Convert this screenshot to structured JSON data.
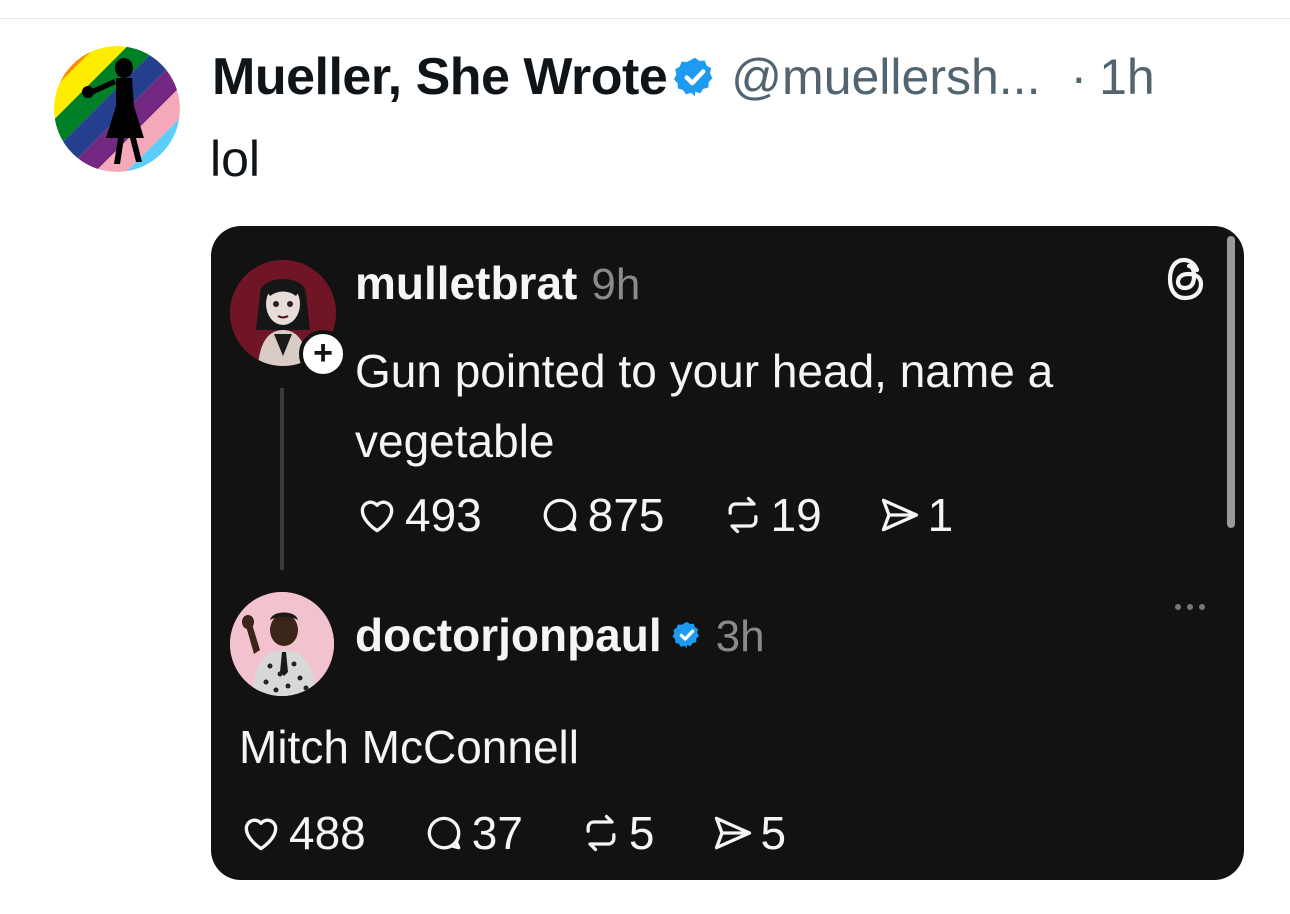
{
  "tweet": {
    "author_name": "Mueller, She Wrote",
    "handle": "@muellersh...",
    "separator": "·",
    "time": "1h",
    "text": "lol"
  },
  "threads_post": {
    "username": "mulletbrat",
    "time": "9h",
    "follow_symbol": "+",
    "text": "Gun pointed to your head, name a vegetable",
    "likes": "493",
    "replies": "875",
    "reposts": "19",
    "shares": "1"
  },
  "threads_reply": {
    "username": "doctorjonpaul",
    "time": "3h",
    "text": "Mitch McConnell",
    "likes": "488",
    "replies": "37",
    "reposts": "5",
    "shares": "5"
  },
  "colors": {
    "verified_blue": "#1d9bf0",
    "card_background": "#121212",
    "secondary_text": "#536471"
  },
  "icons": [
    "pride-silhouette-avatar",
    "verified-badge-icon",
    "threads-logo-icon",
    "heart-icon",
    "comment-icon",
    "repost-icon",
    "share-icon",
    "more-icon"
  ]
}
